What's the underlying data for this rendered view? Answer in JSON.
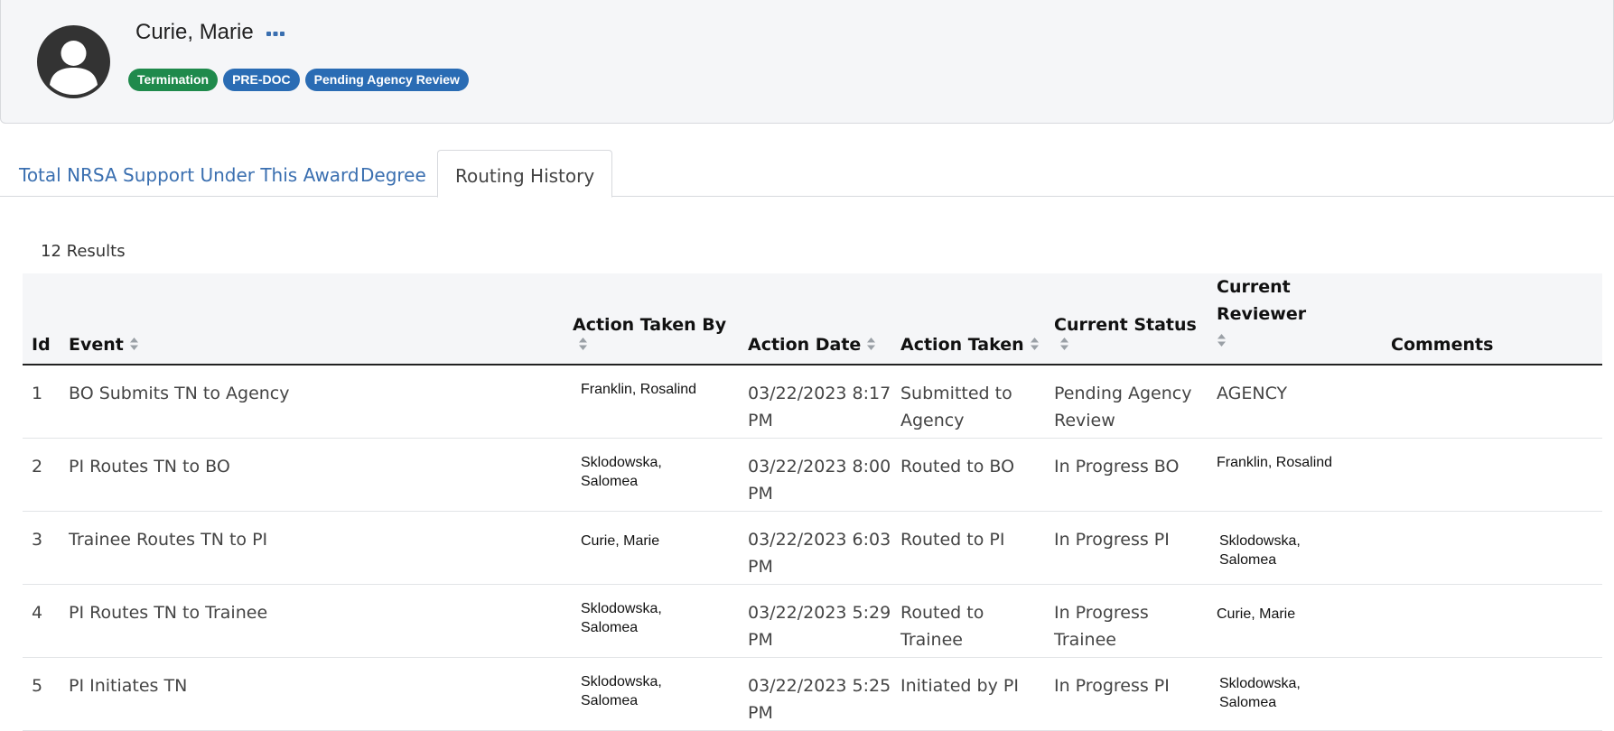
{
  "header": {
    "name": "Curie, Marie",
    "avatar_icon": "user-avatar-icon",
    "more_icon": "ellipsis-icon",
    "badges": [
      {
        "label": "Termination",
        "color": "#1f8a4c"
      },
      {
        "label": "PRE-DOC",
        "color": "#2a6cb4"
      },
      {
        "label": "Pending Agency Review",
        "color": "#2a6cb4"
      }
    ]
  },
  "tabs": [
    {
      "label": "Total NRSA Support Under This Award",
      "active": false
    },
    {
      "label": "Degree",
      "active": false
    },
    {
      "label": "Routing History",
      "active": true
    }
  ],
  "results": {
    "count_label": "12 Results"
  },
  "table": {
    "columns": {
      "id": "Id",
      "event": "Event",
      "action_taken_by": "Action Taken By",
      "action_date": "Action Date",
      "action_taken": "Action Taken",
      "current_status": "Current Status",
      "current_reviewer": "Current Reviewer",
      "comments": "Comments"
    },
    "rows": [
      {
        "id": "1",
        "event": "BO Submits TN to Agency",
        "by": "Franklin, Rosalind",
        "date": "03/22/2023 8:17 PM",
        "action": "Submitted to Agency",
        "status": "Pending Agency Review",
        "reviewer": "AGENCY",
        "comments": ""
      },
      {
        "id": "2",
        "event": "PI Routes TN to BO",
        "by": "Sklodowska, Salomea",
        "date": "03/22/2023 8:00 PM",
        "action": "Routed to BO",
        "status": "In Progress BO",
        "reviewer": "Franklin, Rosalind",
        "comments": ""
      },
      {
        "id": "3",
        "event": "Trainee Routes TN to PI",
        "by": "Curie, Marie",
        "date": "03/22/2023 6:03 PM",
        "action": "Routed to PI",
        "status": "In Progress PI",
        "reviewer": "Sklodowska, Salomea",
        "comments": ""
      },
      {
        "id": "4",
        "event": "PI Routes TN to Trainee",
        "by": "Sklodowska, Salomea",
        "date": "03/22/2023 5:29 PM",
        "action": "Routed to Trainee",
        "status": "In Progress Trainee",
        "reviewer": "Curie, Marie",
        "comments": ""
      },
      {
        "id": "5",
        "event": "PI Initiates TN",
        "by": "Sklodowska, Salomea",
        "date": "03/22/2023 5:25 PM",
        "action": "Initiated by PI",
        "status": "In Progress PI",
        "reviewer": "Sklodowska, Salomea",
        "comments": ""
      }
    ]
  }
}
